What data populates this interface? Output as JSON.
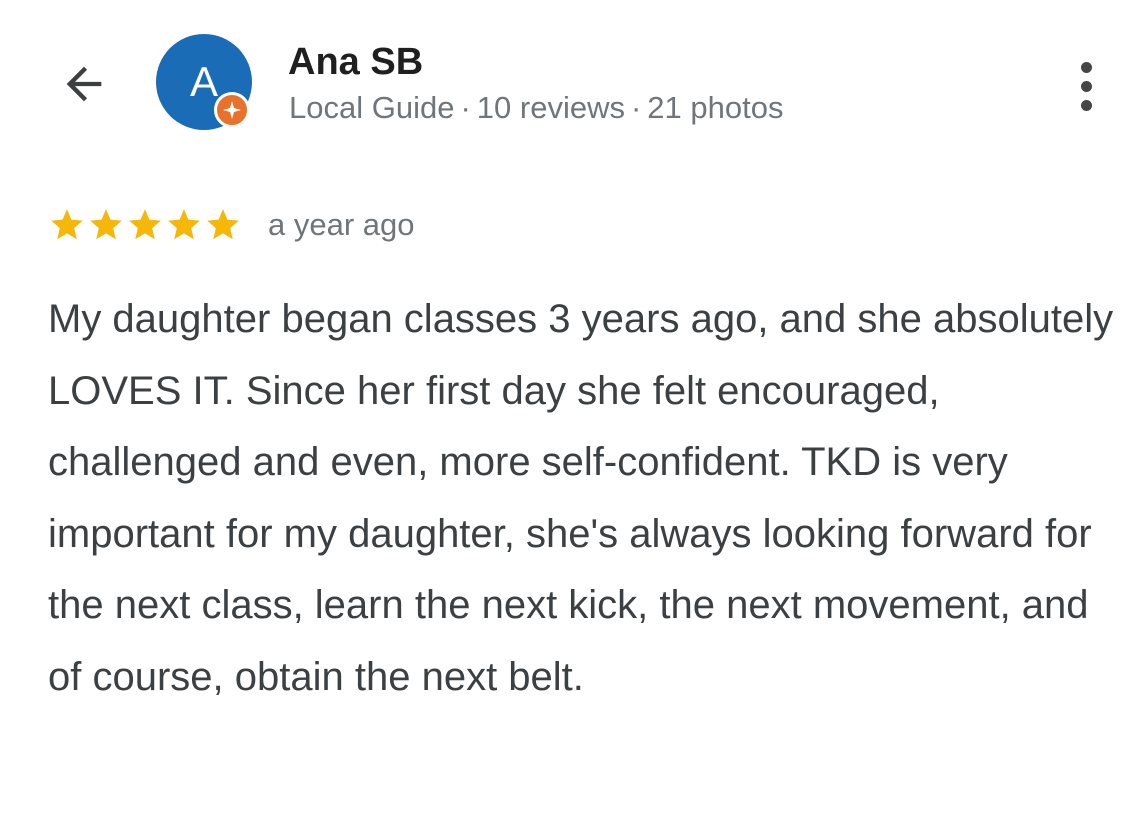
{
  "header": {
    "back_icon": "arrow-left-icon",
    "avatar_letter": "A",
    "avatar_color": "#1a6cb7",
    "badge_color": "#e8712b",
    "user_name": "Ana SB",
    "guide_label": "Local Guide",
    "separator": "·",
    "reviews_count": "10 reviews",
    "photos_count": "21 photos",
    "more_icon": "more-vertical-icon"
  },
  "review": {
    "rating": 5,
    "rating_max": 5,
    "star_color": "#f5b80a",
    "time": "a year ago",
    "text": "My daughter began classes 3 years ago, and she absolutely LOVES IT. Since her first day she felt encouraged, challenged and even, more self-confident. TKD is very important for my daughter, she's always looking forward for the next class, learn the next kick, the next movement, and of course, obtain the next belt."
  }
}
